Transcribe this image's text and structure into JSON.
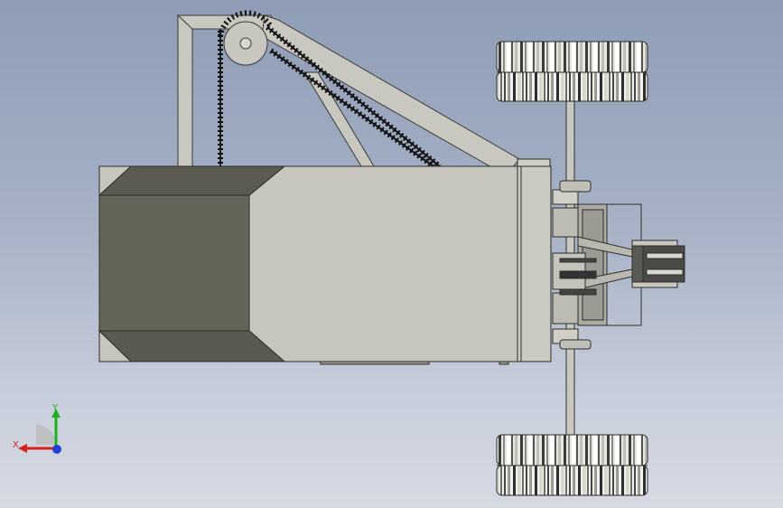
{
  "scene": {
    "description_free": true
  },
  "triad": {
    "x_label": "X",
    "y_label": "Y",
    "x_color": "#d82020",
    "y_color": "#20b020",
    "z_color": "#2040d0"
  },
  "colors": {
    "background_top": "#8e9cb5",
    "background_bottom": "#d6dae3",
    "body_light": "#c5c5bf",
    "body_dark": "#6b6b62",
    "wheel_light": "#f0f0ea",
    "wheel_dark": "#404040"
  }
}
